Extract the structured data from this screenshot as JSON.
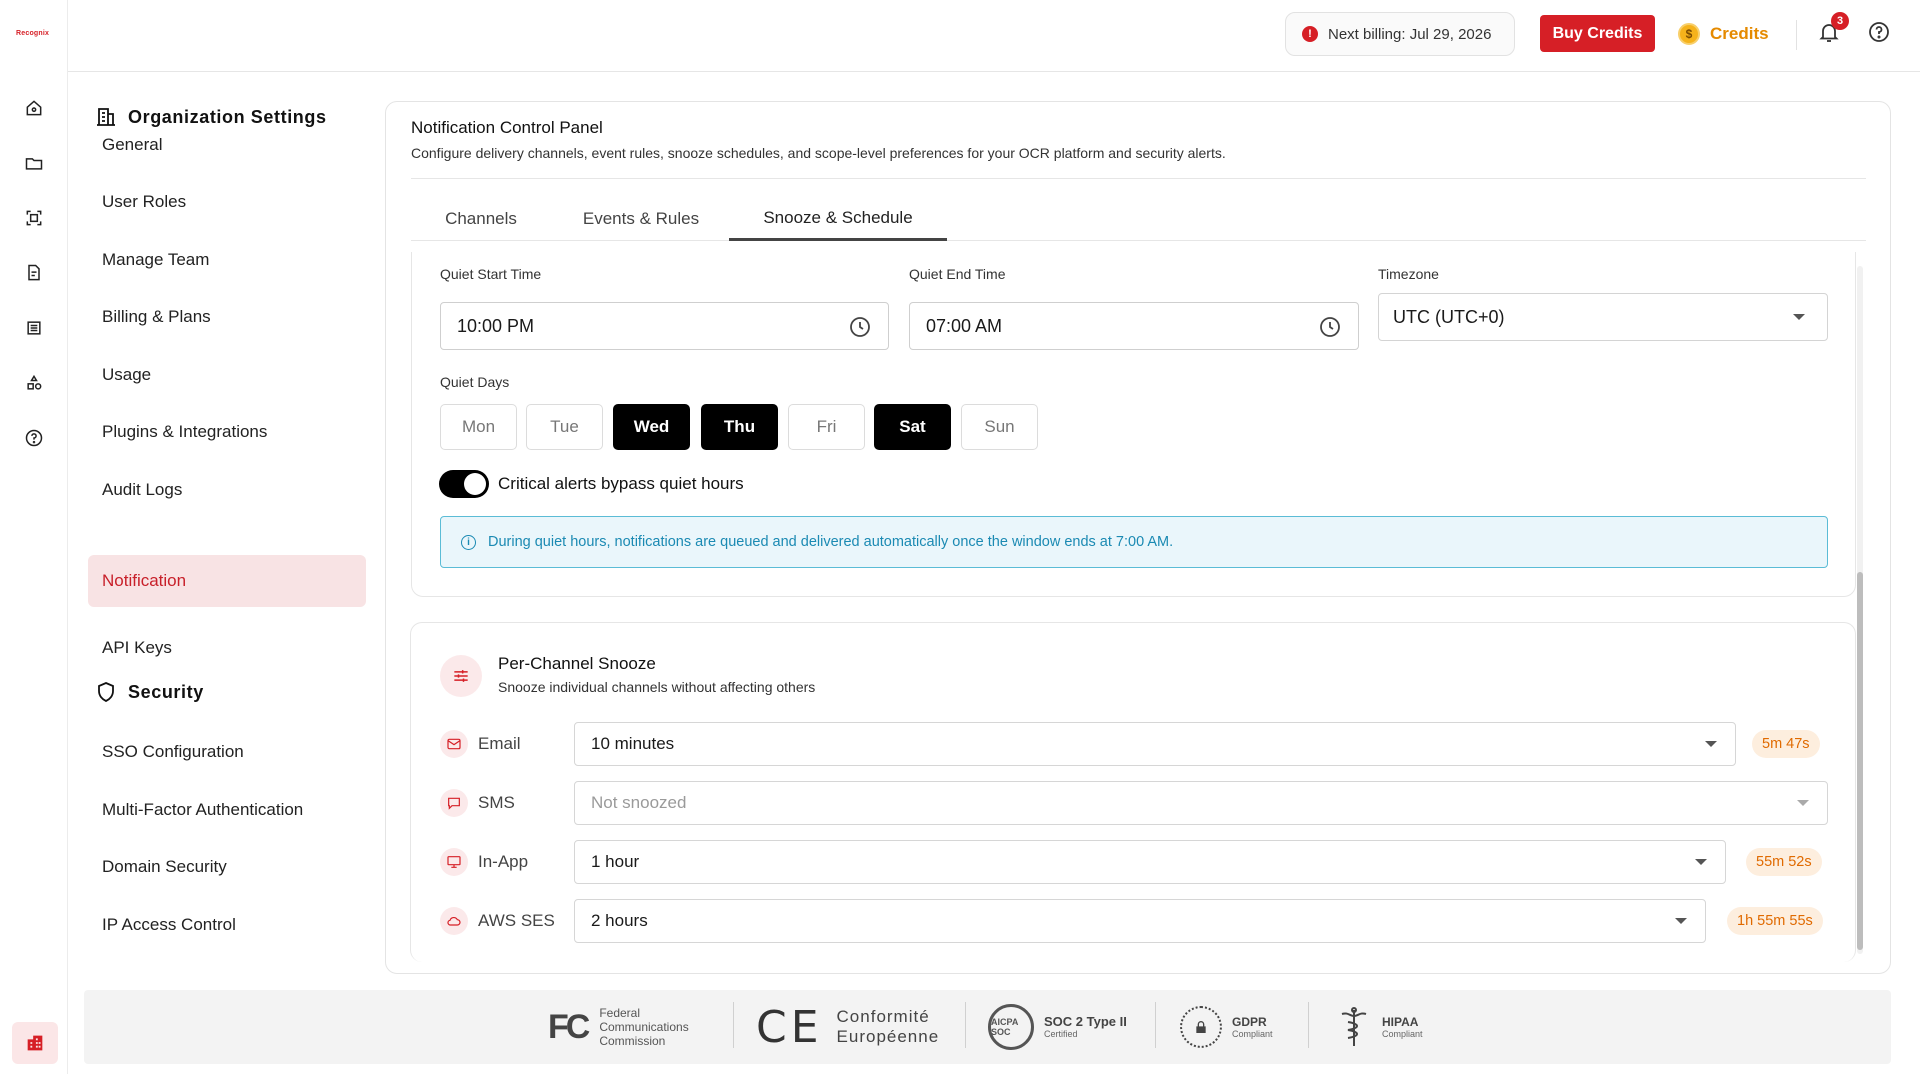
{
  "app": {
    "logo_text": "Recognix"
  },
  "header": {
    "billing_text": "Next billing: Jul 29, 2026",
    "billing_icon": "alert-icon",
    "buy_credits_label": "Buy Credits",
    "credits_label": "Credits",
    "coin_symbol": "$",
    "notification_count": "3",
    "colors": {
      "brand": "#d61f26",
      "credits": "#e58a00"
    }
  },
  "rail": {
    "icons": [
      "home-icon",
      "folder-icon",
      "scan-icon",
      "document-add-icon",
      "list-icon",
      "shapes-icon",
      "help-icon"
    ],
    "bottom_icon": "building-icon"
  },
  "nav": {
    "org_heading": "Organization Settings",
    "org_items": [
      {
        "label": "General"
      },
      {
        "label": "User Roles"
      },
      {
        "label": "Manage Team"
      },
      {
        "label": "Billing & Plans"
      },
      {
        "label": "Usage"
      },
      {
        "label": "Plugins & Integrations"
      },
      {
        "label": "Audit Logs"
      },
      {
        "label": "Notification",
        "active": true
      },
      {
        "label": "API Keys"
      }
    ],
    "security_heading": "Security",
    "security_items": [
      {
        "label": "SSO Configuration"
      },
      {
        "label": "Multi-Factor Authentication"
      },
      {
        "label": "Domain Security"
      },
      {
        "label": "IP Access Control"
      }
    ]
  },
  "panel": {
    "title": "Notification Control Panel",
    "subtitle": "Configure delivery channels, event rules, snooze schedules, and scope-level preferences for your OCR platform and security alerts.",
    "tabs": [
      {
        "label": "Channels"
      },
      {
        "label": "Events & Rules"
      },
      {
        "label": "Snooze & Schedule",
        "active": true
      }
    ]
  },
  "quiet": {
    "start_label": "Quiet Start Time",
    "start_value": "10:00 PM",
    "end_label": "Quiet End Time",
    "end_value": "07:00 AM",
    "tz_label": "Timezone",
    "tz_value": "UTC (UTC+0)",
    "days_label": "Quiet Days",
    "days": [
      {
        "label": "Mon",
        "selected": false
      },
      {
        "label": "Tue",
        "selected": false
      },
      {
        "label": "Wed",
        "selected": true
      },
      {
        "label": "Thu",
        "selected": true
      },
      {
        "label": "Fri",
        "selected": false
      },
      {
        "label": "Sat",
        "selected": true
      },
      {
        "label": "Sun",
        "selected": false
      }
    ],
    "bypass_label": "Critical alerts bypass quiet hours",
    "bypass_on": true,
    "info_text": "During quiet hours, notifications are queued and delivered automatically once the window ends at 7:00 AM."
  },
  "snooze": {
    "title": "Per-Channel Snooze",
    "subtitle": "Snooze individual channels without affecting others",
    "channels": [
      {
        "name": "Email",
        "icon": "mail-icon",
        "value": "10 minutes",
        "remaining": "5m 47s"
      },
      {
        "name": "SMS",
        "icon": "chat-icon",
        "value": "",
        "placeholder": "Not snoozed",
        "remaining": ""
      },
      {
        "name": "In-App",
        "icon": "monitor-icon",
        "value": "1 hour",
        "remaining": "55m 52s"
      },
      {
        "name": "AWS SES",
        "icon": "cloud-icon",
        "value": "2 hours",
        "remaining": "1h 55m 55s"
      }
    ]
  },
  "footer": {
    "fcc": {
      "mark": "FC",
      "line1": "Federal",
      "line2": "Communications",
      "line3": "Commission"
    },
    "ce": {
      "mark": "CE",
      "line1": "Conformité",
      "line2": "Européenne"
    },
    "soc": {
      "ring": "AICPA SOC",
      "title": "SOC 2 Type II",
      "sub": "Certified"
    },
    "gdpr": {
      "title": "GDPR",
      "sub": "Compliant"
    },
    "hipaa": {
      "title": "HIPAA",
      "sub": "Compliant"
    }
  }
}
